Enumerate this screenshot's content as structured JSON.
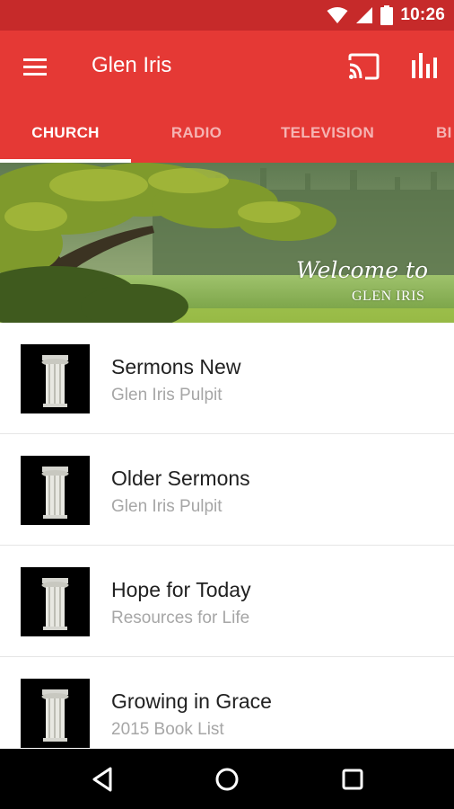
{
  "status_bar": {
    "time": "10:26",
    "icons": [
      "wifi-icon",
      "signal-icon",
      "battery-icon"
    ]
  },
  "app_bar": {
    "title": "Glen Iris",
    "icons": [
      "menu-icon",
      "cast-icon",
      "equalizer-icon"
    ]
  },
  "tabs": [
    {
      "label": "CHURCH",
      "active": true
    },
    {
      "label": "RADIO",
      "active": false
    },
    {
      "label": "TELEVISION",
      "active": false
    },
    {
      "label": "BI",
      "active": false
    }
  ],
  "banner": {
    "script_text": "Welcome to",
    "name_text": "GLEN IRIS"
  },
  "list": [
    {
      "title": "Sermons New",
      "subtitle": "Glen Iris Pulpit"
    },
    {
      "title": "Older Sermons",
      "subtitle": "Glen Iris Pulpit"
    },
    {
      "title": "Hope for Today",
      "subtitle": "Resources for Life"
    },
    {
      "title": "Growing in Grace",
      "subtitle": "2015 Book List"
    }
  ],
  "nav_bar": {
    "icons": [
      "back-icon",
      "home-icon",
      "recents-icon"
    ]
  },
  "colors": {
    "status_bar": "#c62a2a",
    "app_bar": "#e53935",
    "title_text": "#212121",
    "subtitle_text": "#a6a6a6"
  }
}
